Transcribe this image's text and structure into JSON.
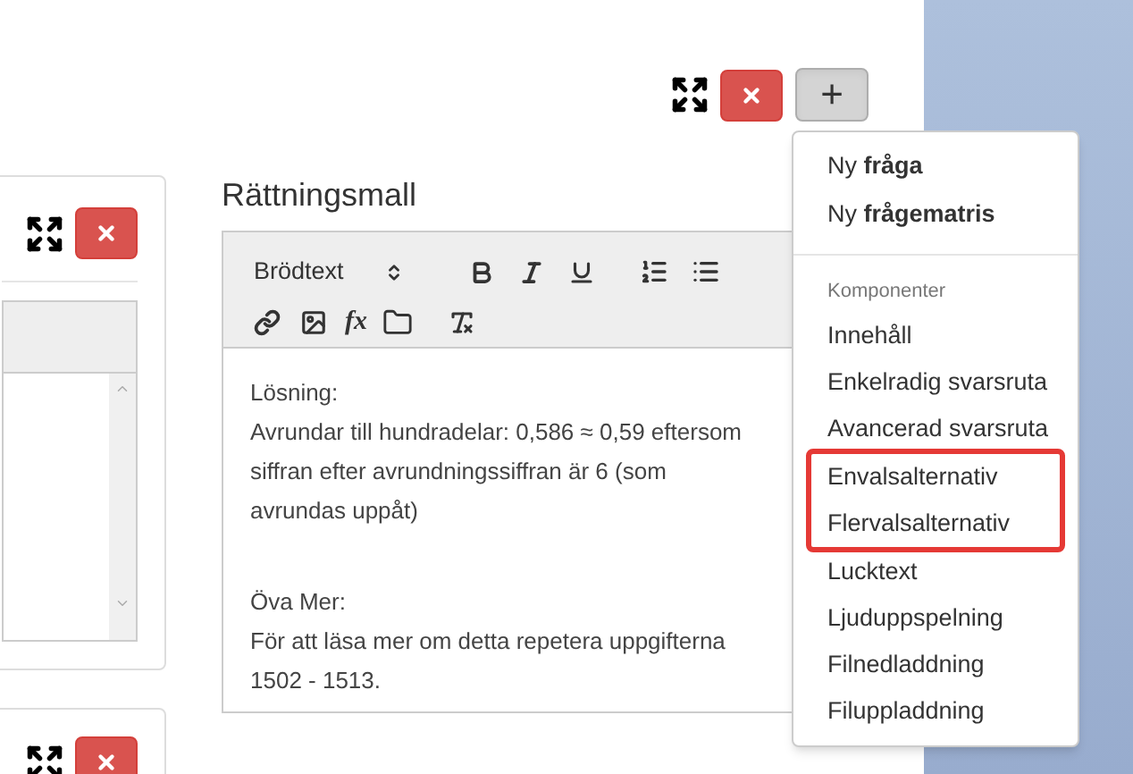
{
  "editor": {
    "title": "Rättningsmall",
    "format_select": "Brödtext",
    "formula_label": "fx",
    "blocks": [
      {
        "lines": [
          "Lösning:",
          "Avrundar till hundradelar: 0,586 ≈ 0,59 eftersom",
          "siffran efter avrundningssiffran är 6 (som",
          "avrundas uppåt)"
        ]
      },
      {
        "lines": [
          "Öva Mer:",
          "För att läsa mer om detta repetera uppgifterna",
          "1502 - 1513."
        ]
      }
    ]
  },
  "add_button": {
    "label": "+",
    "pressed": true
  },
  "add_menu": {
    "new_items": [
      "Ny **fråga**",
      "Ny **frågematris**"
    ],
    "section_header": "Komponenter",
    "components": [
      {
        "label": "Innehåll",
        "highlighted": false
      },
      {
        "label": "Enkelradig svarsruta",
        "highlighted": false
      },
      {
        "label": "Avancerad svarsruta",
        "highlighted": false
      },
      {
        "label": "Envalsalternativ",
        "highlighted": true
      },
      {
        "label": "Flervalsalternativ",
        "highlighted": true
      },
      {
        "label": "Lucktext",
        "highlighted": false
      },
      {
        "label": "Ljuduppspelning",
        "highlighted": false
      },
      {
        "label": "Filnedladdning",
        "highlighted": false
      },
      {
        "label": "Filuppladdning",
        "highlighted": false
      }
    ]
  }
}
